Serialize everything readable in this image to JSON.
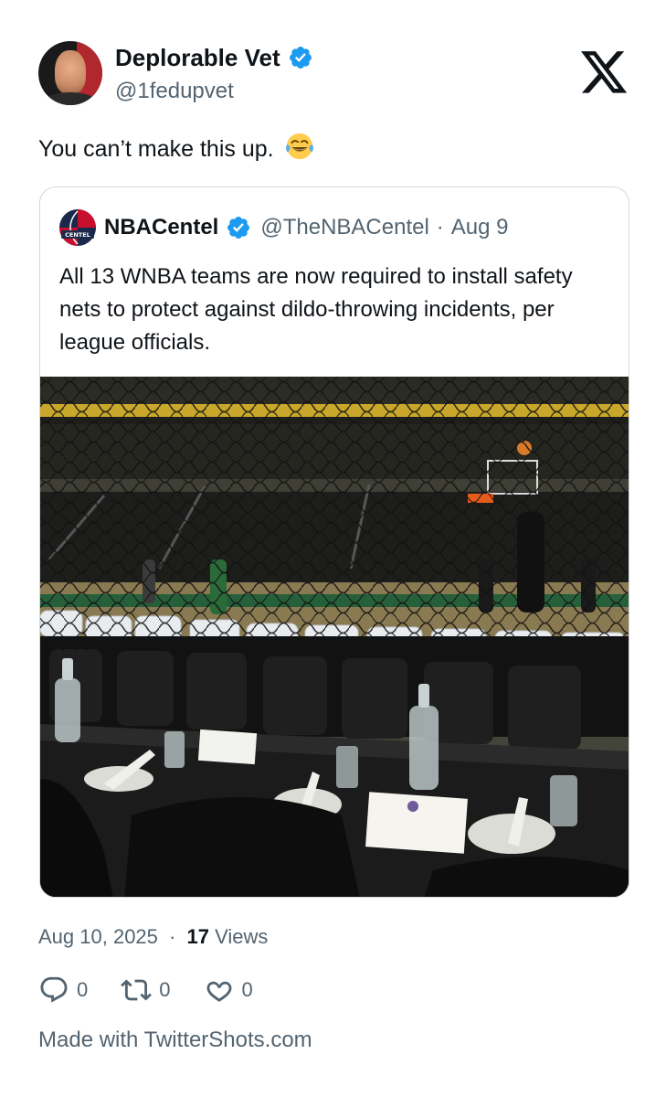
{
  "author": {
    "display_name": "Deplorable Vet",
    "handle": "@1fedupvet",
    "verified": true
  },
  "tweet": {
    "text": "You can’t make this up.",
    "emoji": "face-with-tears-of-joy-icon"
  },
  "quoted_tweet": {
    "display_name": "NBACentel",
    "logo_text": "CENTEL",
    "handle": "@TheNBACentel",
    "separator": "·",
    "date": "Aug 9",
    "text": "All 13 WNBA teams are now required to install safety nets to protect against dildo-throwing incidents, per league officials.",
    "photo_description_icon": "arena-courtside-photo-icon"
  },
  "footer": {
    "date": "Aug 10, 2025",
    "separator": "·",
    "views_count": "17",
    "views_label": "Views",
    "replies": "0",
    "retweets": "0",
    "likes": "0",
    "made_with": "Made with TwitterShots.com"
  },
  "colors": {
    "verified_blue": "#1d9bf0",
    "text_primary": "#0f1419",
    "text_secondary": "#536471",
    "border": "#cfd9de"
  }
}
